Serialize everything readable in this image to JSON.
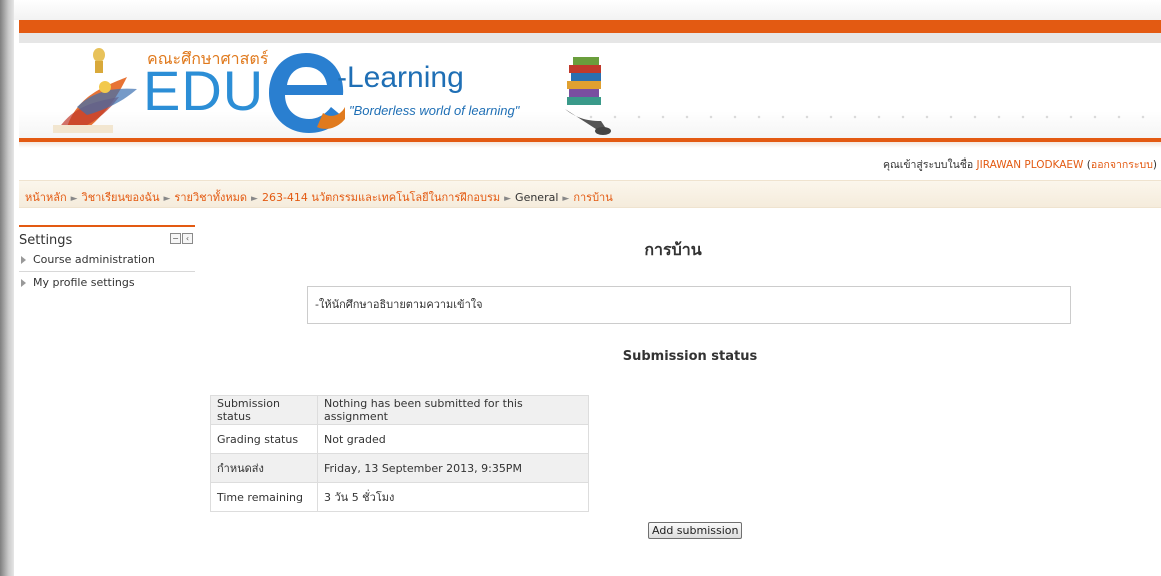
{
  "header": {
    "faculty_name": "คณะศึกษาศาสตร์",
    "logo_text": "EDU",
    "logo_learning": "-Learning",
    "tagline": "\"Borderless world of learning\"",
    "accent_color": "#e35a12",
    "logo_blue": "#2c8ed6"
  },
  "login": {
    "prefix": "คุณเข้าสู่ระบบในชื่อ ",
    "user": "JIRAWAN PLODKAEW",
    "open_paren": " (",
    "logout": "ออกจากระบบ",
    "close_paren": ")"
  },
  "breadcrumb": [
    "หน้าหลัก",
    "วิชาเรียนของฉัน",
    "รายวิชาทั้งหมด",
    "263-414 นวัตกรรมและเทคโนโลยีในการฝึกอบรม",
    "General",
    "การบ้าน"
  ],
  "breadcrumb_sep": "►",
  "settings": {
    "title": "Settings",
    "items": [
      "Course administration",
      "My profile settings"
    ]
  },
  "main": {
    "title": "การบ้าน",
    "intro": "-ให้นักศึกษาอธิบายตามความเข้าใจ",
    "section_title": "Submission status",
    "table": [
      [
        "Submission status",
        "Nothing has been submitted for this assignment"
      ],
      [
        "Grading status",
        "Not graded"
      ],
      [
        "กำหนดส่ง",
        "Friday, 13 September 2013, 9:35PM"
      ],
      [
        "Time remaining",
        "3 วัน 5 ชั่วโมง"
      ]
    ],
    "add_button": "Add submission"
  }
}
